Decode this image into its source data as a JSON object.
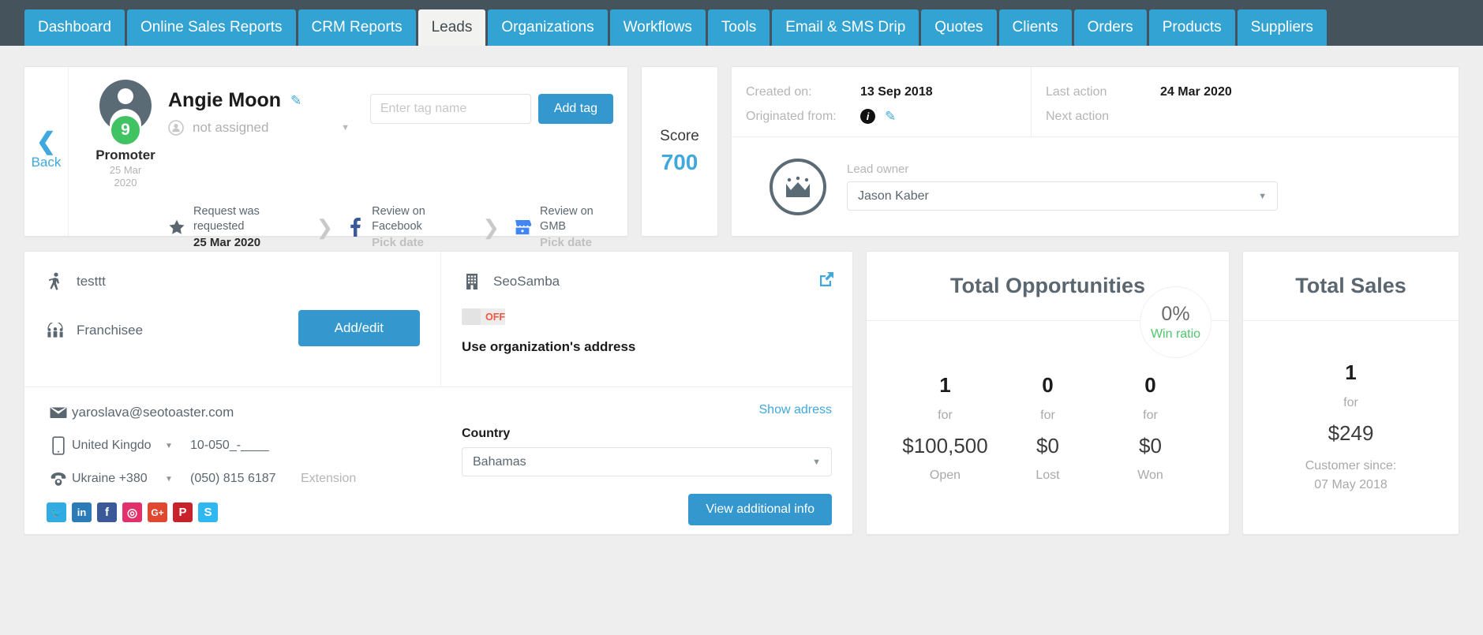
{
  "nav": {
    "tabs": [
      {
        "label": "Dashboard",
        "active": false
      },
      {
        "label": "Online Sales Reports",
        "active": false
      },
      {
        "label": "CRM Reports",
        "active": false
      },
      {
        "label": "Leads",
        "active": true
      },
      {
        "label": "Organizations",
        "active": false
      },
      {
        "label": "Workflows",
        "active": false
      },
      {
        "label": "Tools",
        "active": false
      },
      {
        "label": "Email & SMS Drip",
        "active": false
      },
      {
        "label": "Quotes",
        "active": false
      },
      {
        "label": "Clients",
        "active": false
      },
      {
        "label": "Orders",
        "active": false
      },
      {
        "label": "Products",
        "active": false
      },
      {
        "label": "Suppliers",
        "active": false
      }
    ]
  },
  "profile": {
    "back_label": "Back",
    "avatar_badge": "9",
    "promoter_label": "Promoter",
    "promoter_date": "25 Mar\n2020",
    "lead_name": "Angie Moon",
    "assigned_text": "not assigned",
    "tag_placeholder": "Enter tag name",
    "tag_value": "",
    "add_tag_label": "Add tag",
    "reviews": [
      {
        "icon": "star-icon",
        "title": "Request was requested",
        "value": "25 Mar 2020",
        "muted": false
      },
      {
        "icon": "facebook-icon",
        "title": "Review on Facebook",
        "value": "Pick date",
        "muted": true
      },
      {
        "icon": "gmb-icon",
        "title": "Review on GMB",
        "value": "Pick date",
        "muted": true
      }
    ]
  },
  "score": {
    "label": "Score",
    "value": "700"
  },
  "meta": {
    "created_key": "Created on:",
    "created_value": "13 Sep 2018",
    "originated_key": "Originated from:",
    "last_action_key": "Last action",
    "last_action_value": "24 Mar 2020",
    "next_action_key": "Next action",
    "next_action_value": "",
    "owner_label": "Lead owner",
    "owner_value": "Jason Kaber"
  },
  "contact": {
    "role_value": "testtt",
    "franchisee_label": "Franchisee",
    "add_edit_label": "Add/edit",
    "email": "yaroslava@seotoaster.com",
    "phone_mobile": {
      "country": "United Kingdo",
      "number": "10-050_-____"
    },
    "phone_landline": {
      "country": "Ukraine +380",
      "number": "(050) 815 6187",
      "extension": "Extension"
    },
    "socials": [
      {
        "name": "twitter-icon",
        "glyph": "🐦",
        "color": "#30ace3"
      },
      {
        "name": "linkedin-icon",
        "glyph": "in",
        "color": "#2b7bb9"
      },
      {
        "name": "facebook-icon",
        "glyph": "f",
        "color": "#3b5998"
      },
      {
        "name": "instagram-icon",
        "glyph": "◎",
        "color": "#e1306c"
      },
      {
        "name": "google-plus-icon",
        "glyph": "G+",
        "color": "#e0492f"
      },
      {
        "name": "pinterest-icon",
        "glyph": "P",
        "color": "#c8232c"
      },
      {
        "name": "skype-icon",
        "glyph": "S",
        "color": "#2fb7ef"
      }
    ]
  },
  "organization": {
    "name": "SeoSamba",
    "toggle_state": "OFF",
    "toggle_caption": "Use organization's address",
    "show_address_link": "Show adress",
    "country_label": "Country",
    "country_value": "Bahamas",
    "view_additional_label": "View additional info"
  },
  "opportunities": {
    "title": "Total Opportunities",
    "win_ratio_value": "0%",
    "win_ratio_label": "Win ratio",
    "for_word": "for",
    "columns": [
      {
        "count": "1",
        "amount": "$100,500",
        "status": "Open"
      },
      {
        "count": "0",
        "amount": "$0",
        "status": "Lost"
      },
      {
        "count": "0",
        "amount": "$0",
        "status": "Won"
      }
    ]
  },
  "sales": {
    "title": "Total Sales",
    "count": "1",
    "for_word": "for",
    "amount": "$249",
    "since_label": "Customer since:",
    "since_date": "07 May 2018"
  }
}
